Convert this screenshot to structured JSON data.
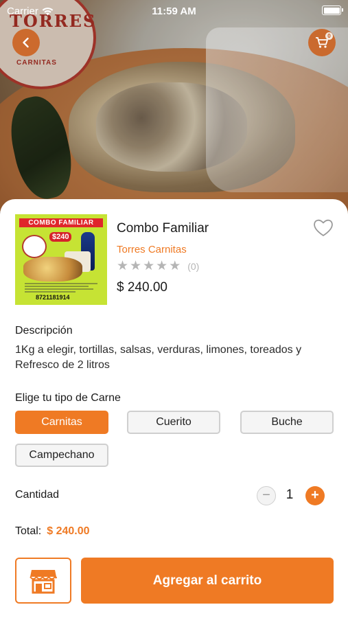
{
  "status_bar": {
    "carrier": "Carrier",
    "time": "11:59 AM",
    "battery_level": 1.0
  },
  "header": {
    "back_icon": "chevron-left-icon",
    "cart_icon": "shopping-cart-icon",
    "cart_badge": "0",
    "hero_logo_text": "TORRES",
    "hero_logo_subtext": "CARNITAS"
  },
  "product": {
    "name": "Combo Familiar",
    "store": "Torres Carnitas",
    "rating": 0,
    "max_rating": 5,
    "rating_count": "(0)",
    "price": "$ 240.00",
    "thumbnail": {
      "title": "COMBO FAMILIAR",
      "price_badge": "$240",
      "phone": "8721181914"
    },
    "favorite_icon": "heart-outline-icon"
  },
  "description": {
    "title": "Descripción",
    "text": "1Kg a elegir, tortillas, salsas, verduras, limones, toreados y Refresco de 2 litros"
  },
  "meat_options": {
    "title": "Elige tu tipo de Carne",
    "options": [
      "Carnitas",
      "Cuerito",
      "Buche",
      "Campechano"
    ],
    "selected": "Carnitas"
  },
  "quantity": {
    "label": "Cantidad",
    "value": "1",
    "minus": "−",
    "plus": "+"
  },
  "total": {
    "label": "Total:",
    "value": "$ 240.00"
  },
  "actions": {
    "store_icon": "storefront-icon",
    "add_to_cart": "Agregar al carrito"
  },
  "colors": {
    "accent": "#ef7a24",
    "star_inactive": "#b5b5b5",
    "option_border": "#cfcfcf"
  }
}
